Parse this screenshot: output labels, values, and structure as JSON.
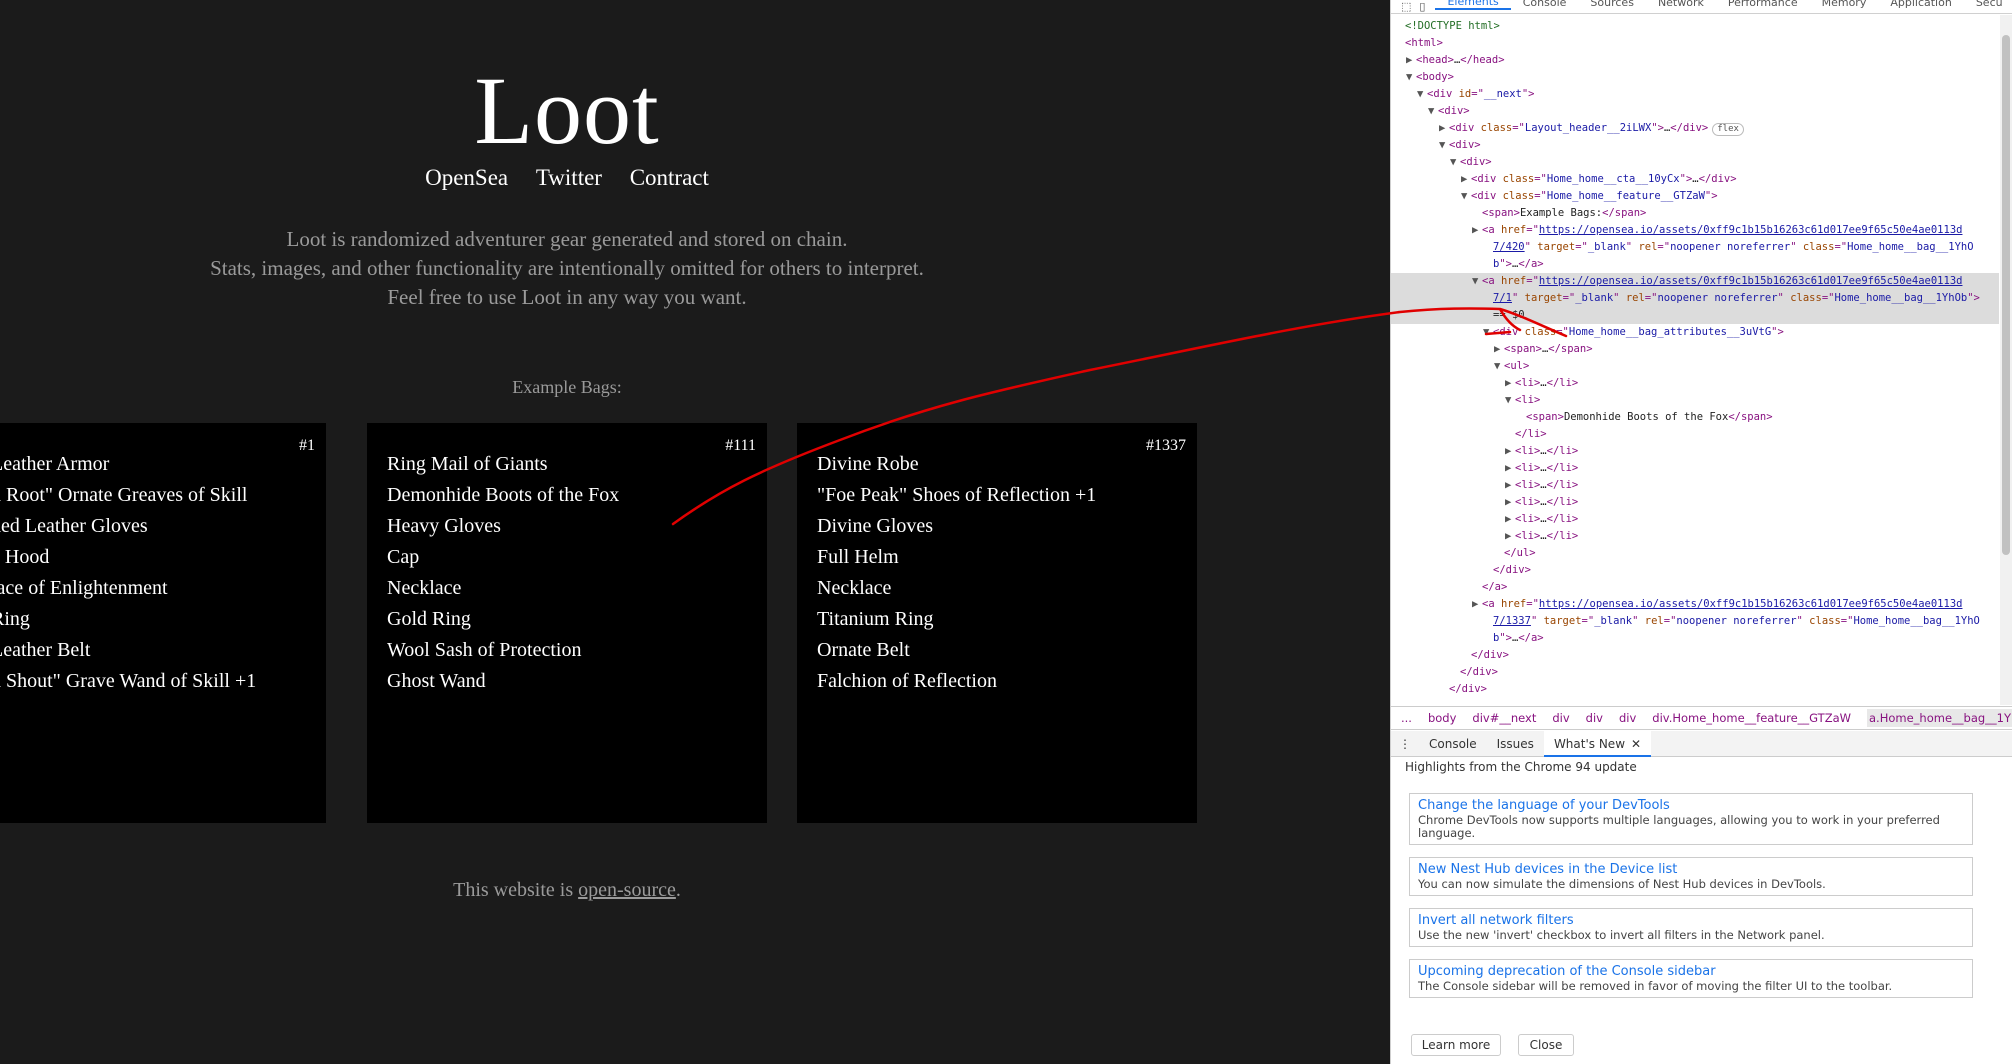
{
  "site": {
    "logo": "Loot",
    "nav": [
      "OpenSea",
      "Twitter",
      "Contract"
    ],
    "intro": [
      "Loot is randomized adventurer gear generated and stored on chain.",
      "Stats, images, and other functionality are intentionally omitted for others to interpret.",
      "Feel free to use Loot in any way you want."
    ],
    "example_label": "Example Bags:",
    "bags": [
      {
        "id": "#1",
        "items": [
          "Leather Armor",
          "h Root\" Ornate Greaves of Skill",
          "ded Leather Gloves",
          "e Hood",
          "lace of Enlightenment",
          "Ring",
          "Leather Belt",
          "n Shout\" Grave Wand of Skill +1"
        ]
      },
      {
        "id": "#111",
        "items": [
          "Ring Mail of Giants",
          "Demonhide Boots of the Fox",
          "Heavy Gloves",
          "Cap",
          "Necklace",
          "Gold Ring",
          "Wool Sash of Protection",
          "Ghost Wand"
        ]
      },
      {
        "id": "#1337",
        "items": [
          "Divine Robe",
          "\"Foe Peak\" Shoes of Reflection +1",
          "Divine Gloves",
          "Full Helm",
          "Necklace",
          "Titanium Ring",
          "Ornate Belt",
          "Falchion of Reflection"
        ]
      }
    ],
    "footer_prefix": "This website is ",
    "footer_link": "open-source",
    "footer_suffix": "."
  },
  "devtools": {
    "tabs": [
      "Elements",
      "Console",
      "Sources",
      "Network",
      "Performance",
      "Memory",
      "Application",
      "Secu"
    ],
    "active_tab": "Elements",
    "tree": [
      {
        "i": 0,
        "a": "",
        "h": "<span class=\"comment\">&lt;!DOCTYPE html&gt;</span>"
      },
      {
        "i": 0,
        "a": "",
        "h": "<span class=\"tag\">&lt;html&gt;</span>"
      },
      {
        "i": 1,
        "a": "▶",
        "h": "<span class=\"tag\">&lt;head&gt;</span><span class=\"txt\">…</span><span class=\"tag\">&lt;/head&gt;</span>"
      },
      {
        "i": 1,
        "a": "▼",
        "h": "<span class=\"tag\">&lt;body&gt;</span>"
      },
      {
        "i": 2,
        "a": "▼",
        "h": "<span class=\"tag\">&lt;div </span><span class=\"attr\">id</span><span class=\"tag\">=\"</span><span class=\"val\">__next</span><span class=\"tag\">\"&gt;</span>"
      },
      {
        "i": 3,
        "a": "▼",
        "h": "<span class=\"tag\">&lt;div&gt;</span>"
      },
      {
        "i": 4,
        "a": "▶",
        "h": "<span class=\"tag\">&lt;div </span><span class=\"attr\">class</span><span class=\"tag\">=\"</span><span class=\"val\">Layout_header__2iLWX</span><span class=\"tag\">\"&gt;</span><span class=\"txt\">…</span><span class=\"tag\">&lt;/div&gt;</span><span class=\"badge\">flex</span>"
      },
      {
        "i": 4,
        "a": "▼",
        "h": "<span class=\"tag\">&lt;div&gt;</span>"
      },
      {
        "i": 5,
        "a": "▼",
        "h": "<span class=\"tag\">&lt;div&gt;</span>"
      },
      {
        "i": 6,
        "a": "▶",
        "h": "<span class=\"tag\">&lt;div </span><span class=\"attr\">class</span><span class=\"tag\">=\"</span><span class=\"val\">Home_home__cta__10yCx</span><span class=\"tag\">\"&gt;</span><span class=\"txt\">…</span><span class=\"tag\">&lt;/div&gt;</span>"
      },
      {
        "i": 6,
        "a": "▼",
        "h": "<span class=\"tag\">&lt;div </span><span class=\"attr\">class</span><span class=\"tag\">=\"</span><span class=\"val\">Home_home__feature__GTZaW</span><span class=\"tag\">\"&gt;</span>"
      },
      {
        "i": 7,
        "a": "",
        "h": "<span class=\"tag\">&lt;span&gt;</span><span class=\"txt\">Example Bags:</span><span class=\"tag\">&lt;/span&gt;</span>"
      },
      {
        "i": 7,
        "a": "▶",
        "h": "<span class=\"tag\">&lt;a </span><span class=\"attr\">href</span><span class=\"tag\">=\"</span><span class=\"link\">https://opensea.io/assets/0xff9c1b15b16263c61d017ee9f65c50e4ae0113d</span>"
      },
      {
        "i": 8,
        "a": "",
        "h": "<span class=\"link\">7/420</span><span class=\"tag\">\" </span><span class=\"attr\">target</span><span class=\"tag\">=\"</span><span class=\"val\">_blank</span><span class=\"tag\">\" </span><span class=\"attr\">rel</span><span class=\"tag\">=\"</span><span class=\"val\">noopener noreferrer</span><span class=\"tag\">\" </span><span class=\"attr\">class</span><span class=\"tag\">=\"</span><span class=\"val\">Home_home__bag__1YhO</span>"
      },
      {
        "i": 8,
        "a": "",
        "h": "<span class=\"val\">b</span><span class=\"tag\">\"&gt;</span><span class=\"txt\">…</span><span class=\"tag\">&lt;/a&gt;</span>"
      },
      {
        "i": 7,
        "a": "▼",
        "h": "<span class=\"tag\">&lt;a </span><span class=\"attr\">href</span><span class=\"tag\">=\"</span><span class=\"link\">https://opensea.io/assets/0xff9c1b15b16263c61d017ee9f65c50e4ae0113d</span>"
      },
      {
        "i": 8,
        "a": "",
        "h": "<span class=\"link\">7/1</span><span class=\"tag\">\" </span><span class=\"attr\">target</span><span class=\"tag\">=\"</span><span class=\"val\">_blank</span><span class=\"tag\">\" </span><span class=\"attr\">rel</span><span class=\"tag\">=\"</span><span class=\"val\">noopener noreferrer</span><span class=\"tag\">\" </span><span class=\"attr\">class</span><span class=\"tag\">=\"</span><span class=\"val\">Home_home__bag__1YhOb</span><span class=\"tag\">\"&gt;</span>"
      },
      {
        "i": 8,
        "a": "",
        "h": "<span class=\"txt\">== $0</span>"
      },
      {
        "i": 8,
        "a": "▼",
        "h": "<span class=\"tag\">&lt;div </span><span class=\"attr\">class</span><span class=\"tag\">=\"</span><span class=\"val\">Home_home__bag_attributes__3uVtG</span><span class=\"tag\">\"&gt;</span>"
      },
      {
        "i": 9,
        "a": "▶",
        "h": "<span class=\"tag\">&lt;span&gt;</span><span class=\"txt\">…</span><span class=\"tag\">&lt;/span&gt;</span>"
      },
      {
        "i": 9,
        "a": "▼",
        "h": "<span class=\"tag\">&lt;ul&gt;</span>"
      },
      {
        "i": 10,
        "a": "▶",
        "h": "<span class=\"tag\">&lt;li&gt;</span><span class=\"txt\">…</span><span class=\"tag\">&lt;/li&gt;</span>"
      },
      {
        "i": 10,
        "a": "▼",
        "h": "<span class=\"tag\">&lt;li&gt;</span>"
      },
      {
        "i": 11,
        "a": "",
        "h": "<span class=\"tag\">&lt;span&gt;</span><span class=\"txt\">Demonhide Boots of the Fox</span><span class=\"tag\">&lt;/span&gt;</span>"
      },
      {
        "i": 10,
        "a": "",
        "h": "<span class=\"tag\">&lt;/li&gt;</span>"
      },
      {
        "i": 10,
        "a": "▶",
        "h": "<span class=\"tag\">&lt;li&gt;</span><span class=\"txt\">…</span><span class=\"tag\">&lt;/li&gt;</span>"
      },
      {
        "i": 10,
        "a": "▶",
        "h": "<span class=\"tag\">&lt;li&gt;</span><span class=\"txt\">…</span><span class=\"tag\">&lt;/li&gt;</span>"
      },
      {
        "i": 10,
        "a": "▶",
        "h": "<span class=\"tag\">&lt;li&gt;</span><span class=\"txt\">…</span><span class=\"tag\">&lt;/li&gt;</span>"
      },
      {
        "i": 10,
        "a": "▶",
        "h": "<span class=\"tag\">&lt;li&gt;</span><span class=\"txt\">…</span><span class=\"tag\">&lt;/li&gt;</span>"
      },
      {
        "i": 10,
        "a": "▶",
        "h": "<span class=\"tag\">&lt;li&gt;</span><span class=\"txt\">…</span><span class=\"tag\">&lt;/li&gt;</span>"
      },
      {
        "i": 10,
        "a": "▶",
        "h": "<span class=\"tag\">&lt;li&gt;</span><span class=\"txt\">…</span><span class=\"tag\">&lt;/li&gt;</span>"
      },
      {
        "i": 9,
        "a": "",
        "h": "<span class=\"tag\">&lt;/ul&gt;</span>"
      },
      {
        "i": 8,
        "a": "",
        "h": "<span class=\"tag\">&lt;/div&gt;</span>"
      },
      {
        "i": 7,
        "a": "",
        "h": "<span class=\"tag\">&lt;/a&gt;</span>"
      },
      {
        "i": 7,
        "a": "▶",
        "h": "<span class=\"tag\">&lt;a </span><span class=\"attr\">href</span><span class=\"tag\">=\"</span><span class=\"link\">https://opensea.io/assets/0xff9c1b15b16263c61d017ee9f65c50e4ae0113d</span>"
      },
      {
        "i": 8,
        "a": "",
        "h": "<span class=\"link\">7/1337</span><span class=\"tag\">\" </span><span class=\"attr\">target</span><span class=\"tag\">=\"</span><span class=\"val\">_blank</span><span class=\"tag\">\" </span><span class=\"attr\">rel</span><span class=\"tag\">=\"</span><span class=\"val\">noopener noreferrer</span><span class=\"tag\">\" </span><span class=\"attr\">class</span><span class=\"tag\">=\"</span><span class=\"val\">Home_home__bag__1YhO</span>"
      },
      {
        "i": 8,
        "a": "",
        "h": "<span class=\"val\">b</span><span class=\"tag\">\"&gt;</span><span class=\"txt\">…</span><span class=\"tag\">&lt;/a&gt;</span>"
      },
      {
        "i": 6,
        "a": "",
        "h": "<span class=\"tag\">&lt;/div&gt;</span>"
      },
      {
        "i": 5,
        "a": "",
        "h": "<span class=\"tag\">&lt;/div&gt;</span>"
      },
      {
        "i": 4,
        "a": "",
        "h": "<span class=\"tag\">&lt;/div&gt;</span>"
      }
    ],
    "breadcrumbs": [
      "...",
      "body",
      "div#__next",
      "div",
      "div",
      "div",
      "div.Home_home__feature__GTZaW",
      "a.Home_home__bag__1YhOb"
    ],
    "drawer_tabs": [
      "Console",
      "Issues",
      "What's New"
    ],
    "drawer_active": "What's New",
    "highlights": "Highlights from the Chrome 94 update",
    "whats_new": [
      {
        "title": "Change the language of your DevTools",
        "desc": "Chrome DevTools now supports multiple languages, allowing you to work in your preferred language."
      },
      {
        "title": "New Nest Hub devices in the Device list",
        "desc": "You can now simulate the dimensions of Nest Hub devices in DevTools."
      },
      {
        "title": "Invert all network filters",
        "desc": "Use the new 'invert' checkbox to invert all filters in the Network panel."
      },
      {
        "title": "Upcoming deprecation of the Console sidebar",
        "desc": "The Console sidebar will be removed in favor of moving the filter UI to the toolbar."
      }
    ],
    "learn_more": "Learn more",
    "close": "Close"
  },
  "annotation_color": "#e00000"
}
